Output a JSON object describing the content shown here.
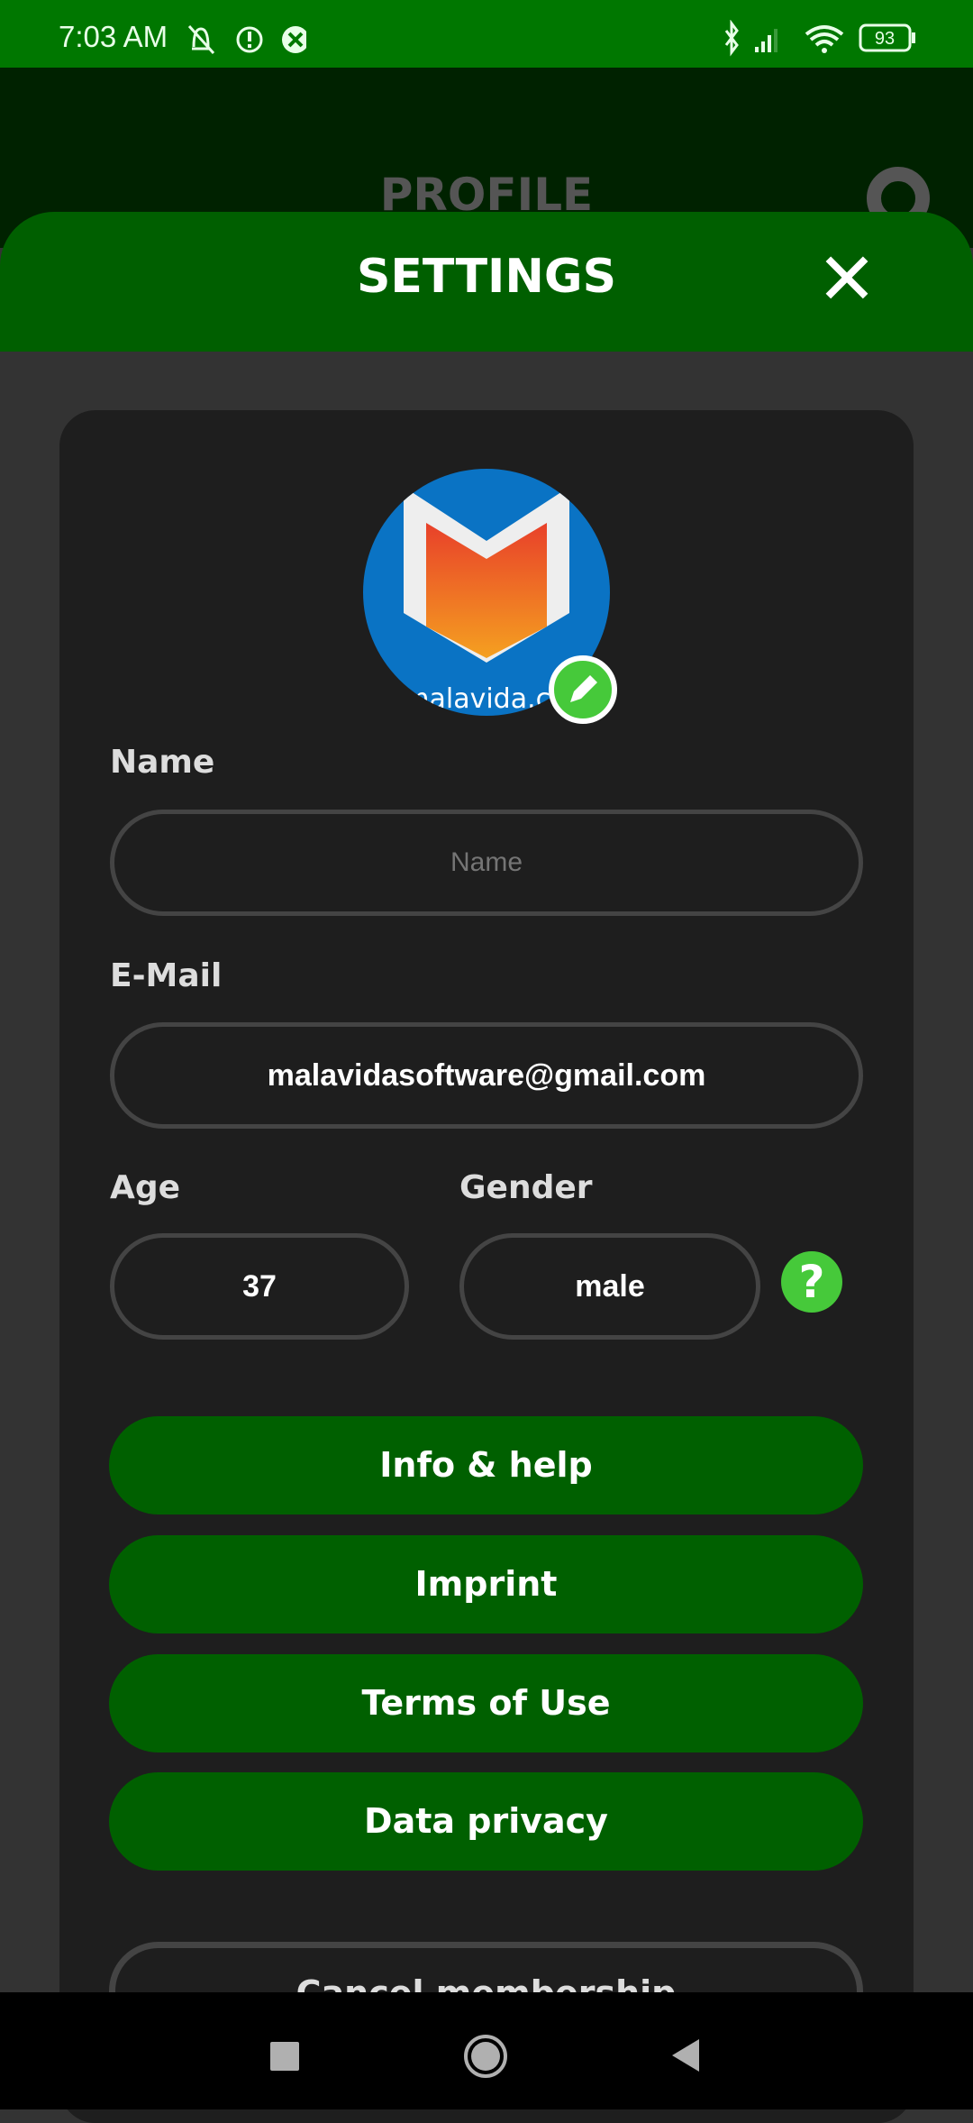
{
  "status_bar": {
    "time": "7:03 AM",
    "battery": "93",
    "icons": [
      "mute-bell-icon",
      "alert-icon",
      "app-icon",
      "bluetooth-icon",
      "signal-icon",
      "wifi-icon",
      "battery-icon"
    ]
  },
  "background_screen": {
    "title": "PROFILE",
    "icon": "gear-icon"
  },
  "settings": {
    "title": "SETTINGS",
    "close_icon": "close-icon",
    "avatar_text": "malavida.com",
    "fields": {
      "name": {
        "label": "Name",
        "value": "",
        "placeholder": "Name"
      },
      "email": {
        "label": "E-Mail",
        "value": "malavidasoftware@gmail.com"
      },
      "age": {
        "label": "Age",
        "value": "37"
      },
      "gender": {
        "label": "Gender",
        "value": "male"
      }
    },
    "help_label": "?",
    "buttons": [
      "Info & help",
      "Imprint",
      "Terms of Use",
      "Data privacy"
    ],
    "cancel_label": "Cancel membership"
  },
  "colors": {
    "status_green": "#007700",
    "header_green": "#005f00",
    "button_green": "#006000",
    "accent_green": "#46c93a"
  }
}
